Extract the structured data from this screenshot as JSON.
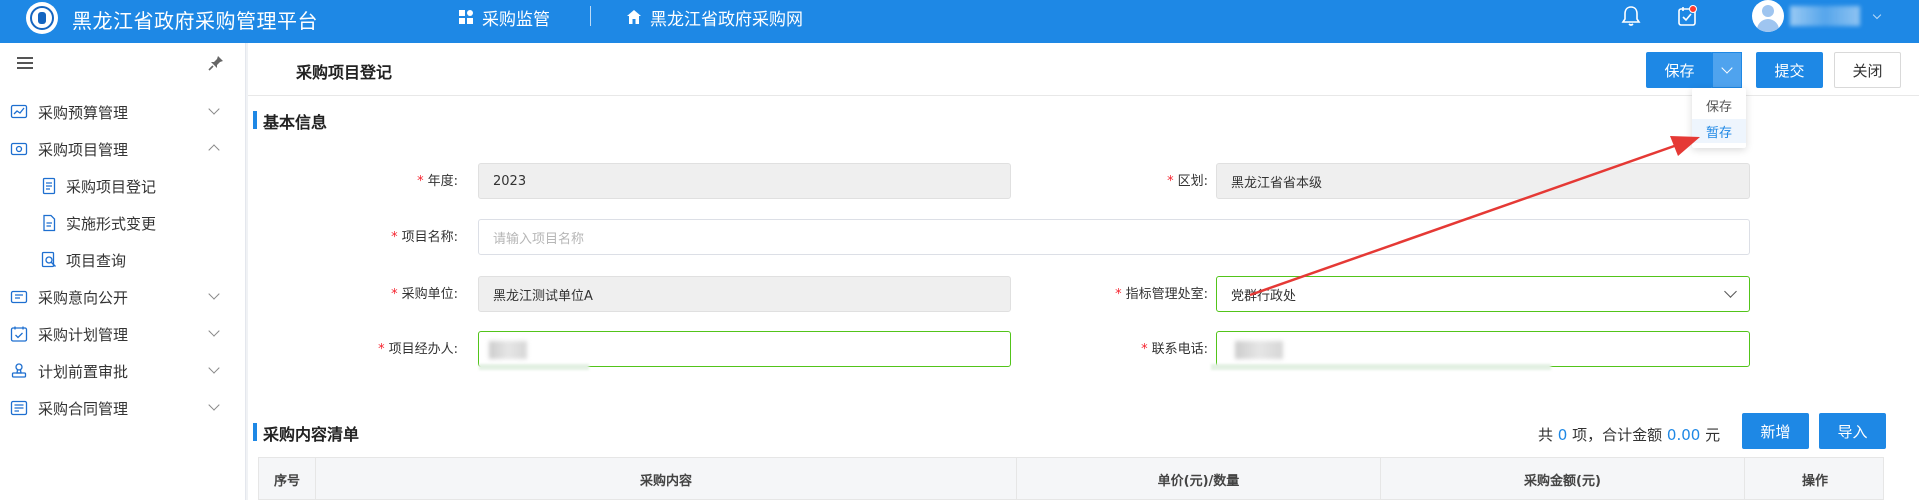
{
  "header": {
    "app_title": "黑龙江省政府采购管理平台",
    "nav": [
      {
        "label": "采购监管",
        "icon": "apps-grid-icon"
      },
      {
        "label": "黑龙江省政府采购网",
        "icon": "home-icon"
      }
    ],
    "icons": [
      "bell-icon",
      "task-check-icon",
      "user-avatar-icon"
    ],
    "brand_color": "#1e88e5"
  },
  "sidebar": {
    "items": [
      {
        "label": "采购预算管理",
        "icon": "chart-icon",
        "expanded": false
      },
      {
        "label": "采购项目管理",
        "icon": "folder-icon",
        "expanded": true
      },
      {
        "label": "采购项目登记",
        "icon": "document-icon",
        "sub": true
      },
      {
        "label": "实施形式变更",
        "icon": "document-edit-icon",
        "sub": true
      },
      {
        "label": "项目查询",
        "icon": "search-doc-icon",
        "sub": true
      },
      {
        "label": "采购意向公开",
        "icon": "announce-icon",
        "expanded": false
      },
      {
        "label": "采购计划管理",
        "icon": "calendar-check-icon",
        "expanded": false
      },
      {
        "label": "计划前置审批",
        "icon": "stamp-icon",
        "expanded": false
      },
      {
        "label": "采购合同管理",
        "icon": "contract-icon",
        "expanded": false
      }
    ]
  },
  "page": {
    "title": "采购项目登记",
    "buttons": {
      "save": "保存",
      "submit": "提交",
      "close": "关闭"
    },
    "save_menu": [
      "保存",
      "暂存"
    ]
  },
  "basic_info": {
    "title": "基本信息",
    "year_label": "年度:",
    "year_value": "2023",
    "region_label": "区划:",
    "region_value": "黑龙江省省本级",
    "project_name_label": "项目名称:",
    "project_name_placeholder": "请输入项目名称",
    "purchaser_label": "采购单位:",
    "purchaser_value": "黑龙江测试单位A",
    "office_label": "指标管理处室:",
    "office_value": "党群行政处",
    "manager_label": "项目经办人:",
    "phone_label": "联系电话:"
  },
  "content_list": {
    "title": "采购内容清单",
    "summary_prefix": "共",
    "count": "0",
    "summary_mid": "项，合计金额",
    "amount": "0.00",
    "summary_unit": "元",
    "add_label": "新增",
    "import_label": "导入",
    "columns": [
      "序号",
      "采购内容",
      "单价(元)/数量",
      "采购金额(元)",
      "操作"
    ]
  },
  "annotation_color": "#e53935"
}
